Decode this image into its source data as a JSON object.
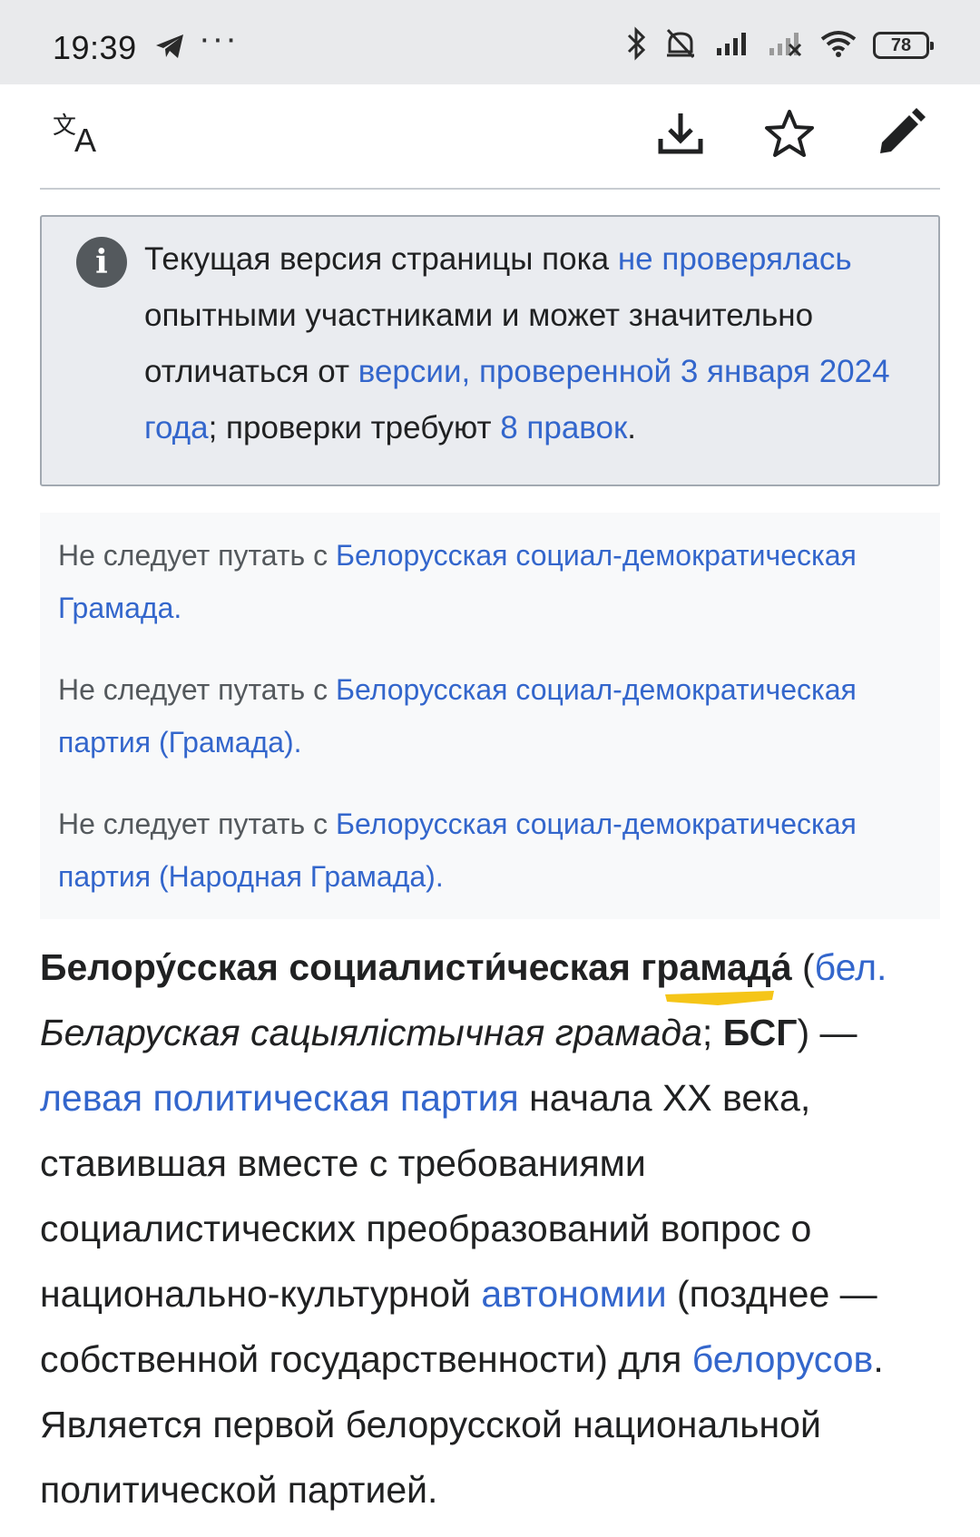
{
  "status_bar": {
    "time": "19:39",
    "more": "···",
    "battery": "78"
  },
  "toolbar": {
    "icons": [
      "translate-icon",
      "download-icon",
      "star-icon",
      "edit-icon"
    ]
  },
  "notice": {
    "t1": "Текущая версия страницы пока ",
    "l1": "не проверялась",
    "t2": " опытными участниками и может значительно отличаться от ",
    "l2": "версии, проверенной 3 января 2024 года",
    "t3": "; проверки требуют ",
    "l3": "8 правок",
    "t4": "."
  },
  "hatnotes": [
    {
      "prefix": "Не следует путать с ",
      "link": "Белорусская социал-демократическая Грамада",
      "suffix": "."
    },
    {
      "prefix": "Не следует путать с ",
      "link": "Белорусская социал-демократическая партия (Грамада)",
      "suffix": "."
    },
    {
      "prefix": "Не следует путать с ",
      "link": "Белорусская социал-демократическая партия (Народная Грамада)",
      "suffix": "."
    }
  ],
  "article": {
    "title_bold": "Белору́сская социалисти́ческая грамада́",
    "p_open": " (",
    "lang_link": "бел.",
    "native_italic": " Беларуская сацыялістычная грамада",
    "sep": "; ",
    "abbr_bold": "БСГ",
    "dash": ") — ",
    "link_party": "левая политическая партия",
    "t1": " начала XX века, ставившая вместе с требованиями социалистических преобразований вопрос о национально-культурной ",
    "link_autonomy": "автономии",
    "t2": " (позднее — собственной государственности) для ",
    "link_belarusians": "белорусов",
    "t3": ". Является первой белорусской национальной политической партией."
  },
  "colors": {
    "link": "#3366cc",
    "notice_bg": "#eaecf0",
    "hatnote_bg": "#f8f9fa",
    "highlight": "#f5c518"
  }
}
